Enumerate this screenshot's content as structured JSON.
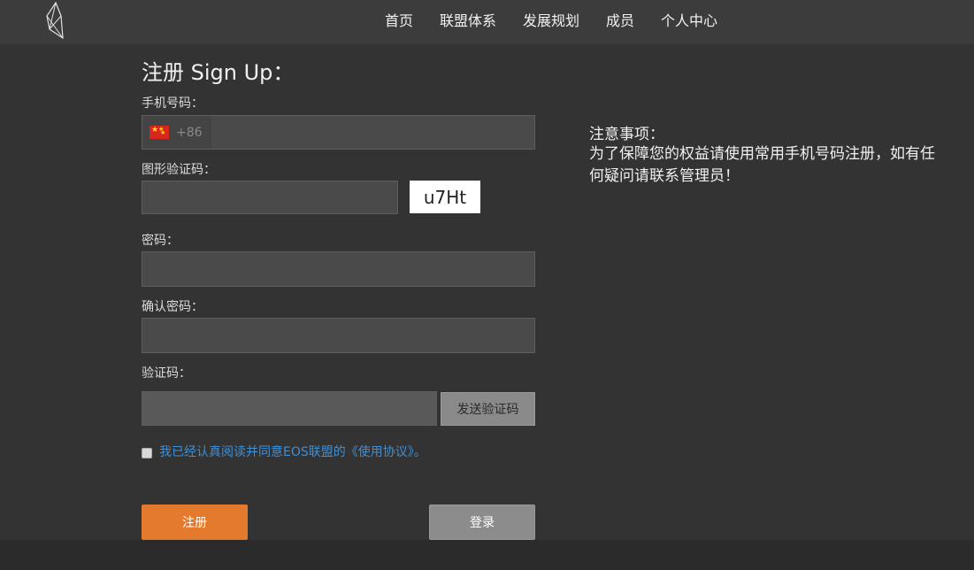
{
  "nav": {
    "items": [
      {
        "label": "首页"
      },
      {
        "label": "联盟体系"
      },
      {
        "label": "发展规划"
      },
      {
        "label": "成员"
      },
      {
        "label": "个人中心"
      }
    ]
  },
  "form": {
    "title": "注册 Sign Up：",
    "phone_label": "手机号码：",
    "phone_country_code": "+86",
    "phone_flag_icon": "china-flag-icon",
    "phone_value": "",
    "captcha_label": "图形验证码：",
    "captcha_value": "",
    "captcha_text": "u7Ht",
    "password_label": "密码：",
    "password_value": "",
    "confirm_label": "确认密码：",
    "confirm_value": "",
    "sms_label": "验证码：",
    "sms_value": "",
    "sms_button": "发送验证码",
    "agree_checked": false,
    "agree_text": "我已经认真阅读并同意EOS联盟的《使用协议》。",
    "register_button": "注册",
    "login_button": "登录"
  },
  "notes": {
    "title": "注意事项：",
    "body": "为了保障您的权益请使用常用手机号码注册，如有任何疑问请联系管理员！"
  },
  "colors": {
    "background": "#333333",
    "topbar": "#3c3c3c",
    "accent_orange": "#e47a2e",
    "link_blue": "#3d8fd6"
  }
}
